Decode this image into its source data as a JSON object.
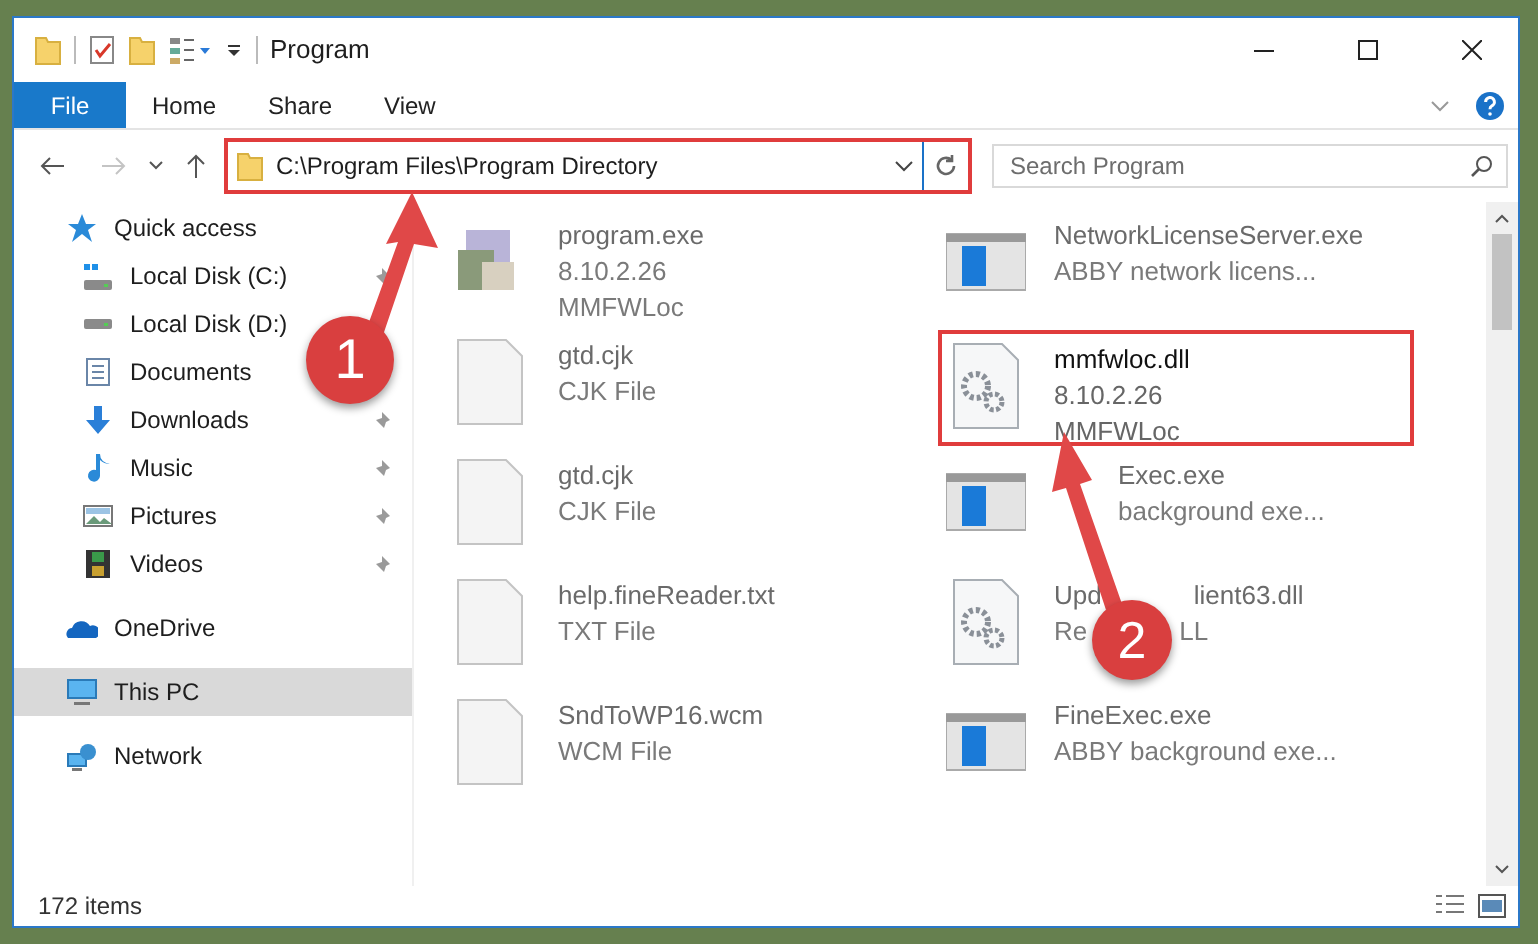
{
  "window": {
    "title": "Program"
  },
  "ribbon": {
    "tabs": [
      {
        "label": "File",
        "selected": true
      },
      {
        "label": "Home",
        "selected": false
      },
      {
        "label": "Share",
        "selected": false
      },
      {
        "label": "View",
        "selected": false
      }
    ]
  },
  "address": {
    "path": "C:\\Program Files\\Program Directory",
    "highlighted": true
  },
  "search": {
    "placeholder": "Search Program"
  },
  "sidebar": {
    "items": [
      {
        "label": "Quick access",
        "kind": "star",
        "pinned": false,
        "selected": false,
        "group_start": false
      },
      {
        "label": "Local Disk (C:)",
        "kind": "disk-c",
        "pinned": true,
        "selected": false,
        "group_start": false
      },
      {
        "label": "Local Disk (D:)",
        "kind": "disk",
        "selected": false,
        "group_start": false
      },
      {
        "label": "Documents",
        "kind": "document",
        "selected": false,
        "group_start": false
      },
      {
        "label": "Downloads",
        "kind": "download",
        "pinned": true,
        "selected": false,
        "group_start": false
      },
      {
        "label": "Music",
        "kind": "music",
        "pinned": true,
        "selected": false,
        "group_start": false
      },
      {
        "label": "Pictures",
        "kind": "pictures",
        "pinned": true,
        "selected": false,
        "group_start": false
      },
      {
        "label": "Videos",
        "kind": "videos",
        "pinned": true,
        "selected": false,
        "group_start": false
      },
      {
        "label": "OneDrive",
        "kind": "cloud",
        "pinned": false,
        "selected": false,
        "group_start": true
      },
      {
        "label": "This PC",
        "kind": "pc",
        "pinned": false,
        "selected": true,
        "group_start": true
      },
      {
        "label": "Network",
        "kind": "network",
        "pinned": false,
        "selected": false,
        "group_start": true
      }
    ]
  },
  "files": [
    {
      "kind": "program",
      "name": [
        "program.exe"
      ],
      "details": [
        [
          "8.10.2.26"
        ],
        [
          "MMFWLoc"
        ]
      ],
      "blurred": true,
      "highlighted": false,
      "covered_start": false
    },
    {
      "kind": "window",
      "name": [
        "NetworkLicenseServer.exe"
      ],
      "details": [
        [
          "ABBY network licens..."
        ]
      ],
      "blurred": true,
      "highlighted": false,
      "covered_start": false
    },
    {
      "kind": "document",
      "name": [
        "gtd.cjk"
      ],
      "details": [
        [
          "CJK File"
        ]
      ],
      "blurred": true,
      "highlighted": false,
      "covered_start": false
    },
    {
      "kind": "gear",
      "name": [
        "mmfwloc.dll"
      ],
      "details": [
        [
          "8.10.2.26"
        ],
        [
          "MMFWLoc"
        ]
      ],
      "blurred": false,
      "highlighted": true,
      "covered_start": false
    },
    {
      "kind": "document",
      "name": [
        "gtd.cjk"
      ],
      "details": [
        [
          "CJK File"
        ]
      ],
      "blurred": true,
      "highlighted": false,
      "covered_start": false
    },
    {
      "kind": "window",
      "name": [
        "Exec.exe"
      ],
      "details": [
        [
          "background exe..."
        ]
      ],
      "blurred": true,
      "highlighted": false,
      "covered_start": true
    },
    {
      "kind": "document",
      "name": [
        "help.fineReader.txt"
      ],
      "details": [
        [
          "TXT File"
        ]
      ],
      "blurred": true,
      "highlighted": false,
      "covered_start": false
    },
    {
      "kind": "gear",
      "name": [
        "Upd",
        "lient63.dll"
      ],
      "details": [
        [
          "Re",
          "LL"
        ]
      ],
      "blurred": true,
      "highlighted": false,
      "covered_start": false
    },
    {
      "kind": "document",
      "name": [
        "SndToWP16.wcm"
      ],
      "details": [
        [
          "WCM File"
        ]
      ],
      "blurred": true,
      "highlighted": false,
      "covered_start": false
    },
    {
      "kind": "window",
      "name": [
        "FineExec.exe"
      ],
      "details": [
        [
          "ABBY background exe..."
        ]
      ],
      "blurred": true,
      "highlighted": false,
      "covered_start": false
    }
  ],
  "status_bar": {
    "count": "172 items"
  },
  "annotations": [
    {
      "label": "1"
    },
    {
      "label": "2"
    }
  ]
}
